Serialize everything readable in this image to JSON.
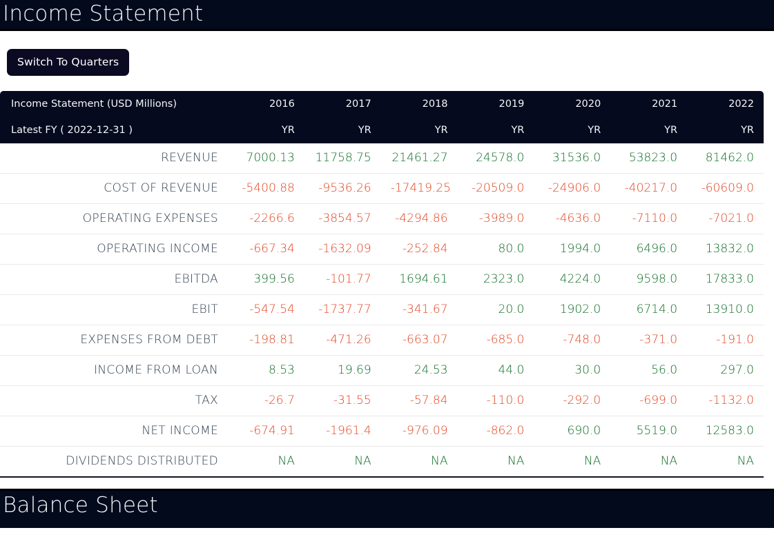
{
  "sections": {
    "income_statement_title": "Income Statement",
    "balance_sheet_title": "Balance Sheet"
  },
  "toolbar": {
    "switch_label": "Switch To Quarters"
  },
  "colors": {
    "header_bg": "#060a1e",
    "title_bar_bg": "#030a1c",
    "positive": "#0b6b23",
    "negative": "#e0431f",
    "row_label": "#2e3d4d",
    "button_bg": "#0a0a23"
  },
  "table": {
    "corner_label": "Income Statement (USD Millions)",
    "period_label": "Latest FY ( 2022-12-31 )",
    "columns": [
      "2016",
      "2017",
      "2018",
      "2019",
      "2020",
      "2021",
      "2022"
    ],
    "period_units": [
      "YR",
      "YR",
      "YR",
      "YR",
      "YR",
      "YR",
      "YR"
    ],
    "rows": [
      {
        "label": "REVENUE",
        "values": [
          "7000.13",
          "11758.75",
          "21461.27",
          "24578.0",
          "31536.0",
          "53823.0",
          "81462.0"
        ],
        "signs": [
          "pos",
          "pos",
          "pos",
          "pos",
          "pos",
          "pos",
          "pos"
        ]
      },
      {
        "label": "COST OF REVENUE",
        "values": [
          "-5400.88",
          "-9536.26",
          "-17419.25",
          "-20509.0",
          "-24906.0",
          "-40217.0",
          "-60609.0"
        ],
        "signs": [
          "neg",
          "neg",
          "neg",
          "neg",
          "neg",
          "neg",
          "neg"
        ]
      },
      {
        "label": "OPERATING EXPENSES",
        "values": [
          "-2266.6",
          "-3854.57",
          "-4294.86",
          "-3989.0",
          "-4636.0",
          "-7110.0",
          "-7021.0"
        ],
        "signs": [
          "neg",
          "neg",
          "neg",
          "neg",
          "neg",
          "neg",
          "neg"
        ]
      },
      {
        "label": "OPERATING INCOME",
        "values": [
          "-667.34",
          "-1632.09",
          "-252.84",
          "80.0",
          "1994.0",
          "6496.0",
          "13832.0"
        ],
        "signs": [
          "neg",
          "neg",
          "neg",
          "pos",
          "pos",
          "pos",
          "pos"
        ]
      },
      {
        "label": "EBITDA",
        "values": [
          "399.56",
          "-101.77",
          "1694.61",
          "2323.0",
          "4224.0",
          "9598.0",
          "17833.0"
        ],
        "signs": [
          "pos",
          "neg",
          "pos",
          "pos",
          "pos",
          "pos",
          "pos"
        ]
      },
      {
        "label": "EBIT",
        "values": [
          "-547.54",
          "-1737.77",
          "-341.67",
          "20.0",
          "1902.0",
          "6714.0",
          "13910.0"
        ],
        "signs": [
          "neg",
          "neg",
          "neg",
          "pos",
          "pos",
          "pos",
          "pos"
        ]
      },
      {
        "label": "EXPENSES FROM DEBT",
        "values": [
          "-198.81",
          "-471.26",
          "-663.07",
          "-685.0",
          "-748.0",
          "-371.0",
          "-191.0"
        ],
        "signs": [
          "neg",
          "neg",
          "neg",
          "neg",
          "neg",
          "neg",
          "neg"
        ]
      },
      {
        "label": "INCOME FROM LOAN",
        "values": [
          "8.53",
          "19.69",
          "24.53",
          "44.0",
          "30.0",
          "56.0",
          "297.0"
        ],
        "signs": [
          "pos",
          "pos",
          "pos",
          "pos",
          "pos",
          "pos",
          "pos"
        ]
      },
      {
        "label": "TAX",
        "values": [
          "-26.7",
          "-31.55",
          "-57.84",
          "-110.0",
          "-292.0",
          "-699.0",
          "-1132.0"
        ],
        "signs": [
          "neg",
          "neg",
          "neg",
          "neg",
          "neg",
          "neg",
          "neg"
        ]
      },
      {
        "label": "NET INCOME",
        "values": [
          "-674.91",
          "-1961.4",
          "-976.09",
          "-862.0",
          "690.0",
          "5519.0",
          "12583.0"
        ],
        "signs": [
          "neg",
          "neg",
          "neg",
          "neg",
          "pos",
          "pos",
          "pos"
        ]
      },
      {
        "label": "DIVIDENDS DISTRIBUTED",
        "values": [
          "NA",
          "NA",
          "NA",
          "NA",
          "NA",
          "NA",
          "NA"
        ],
        "signs": [
          "na",
          "na",
          "na",
          "na",
          "na",
          "na",
          "na"
        ]
      }
    ]
  }
}
